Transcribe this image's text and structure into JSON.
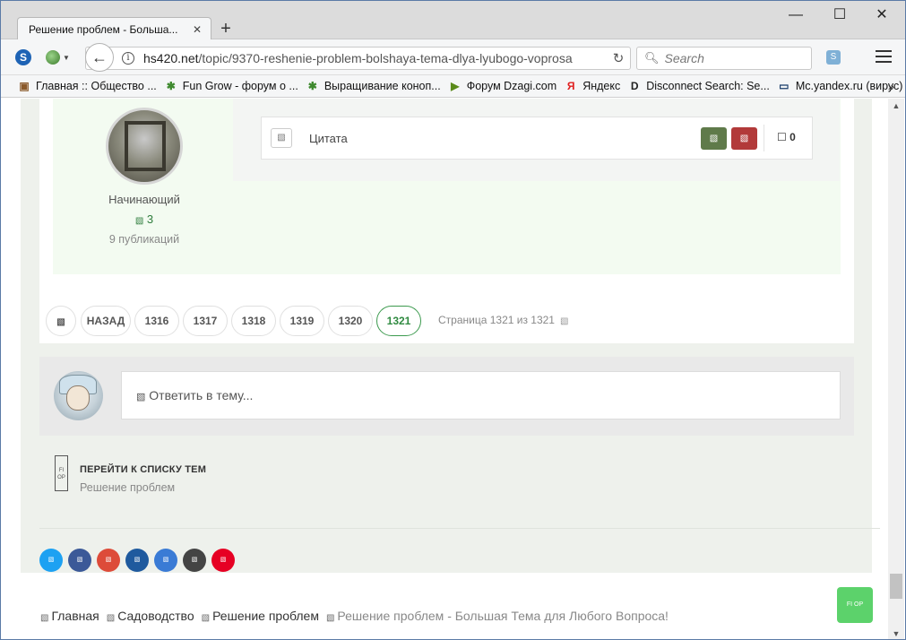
{
  "browser": {
    "tab_title": "Решение проблем - Больша...",
    "url_domain": "hs420.net",
    "url_path": "/topic/9370-reshenie-problem-bolshaya-tema-dlya-lyubogo-voprosa",
    "search_placeholder": "Search",
    "window_controls": {
      "minimize": "—",
      "maximize": "☐",
      "close": "✕"
    }
  },
  "bookmarks": [
    {
      "label": "Главная :: Общество ...",
      "icon": "site-icon",
      "color": "#8a5a2b"
    },
    {
      "label": "Fun Grow - форум о ...",
      "icon": "leaf-icon",
      "color": "#3f8a2f"
    },
    {
      "label": "Выращивание коноп...",
      "icon": "leaf-icon",
      "color": "#3f8a2f"
    },
    {
      "label": "Форум Dzagi.com",
      "icon": "play-icon",
      "color": "#5a8a1a"
    },
    {
      "label": "Яндекс",
      "icon": "yandex-icon",
      "color": "#e02020"
    },
    {
      "label": "Disconnect Search: Se...",
      "icon": "d-icon",
      "color": "#222222"
    },
    {
      "label": "Mc.yandex.ru (вирус)",
      "icon": "monitor-icon",
      "color": "#1a3d6b"
    }
  ],
  "post": {
    "quote_label": "Цитата",
    "reaction_count": "0",
    "author": {
      "rank": "Начинающий",
      "reputation": "3",
      "posts": "9 публикаций"
    }
  },
  "pagination": {
    "prev_label": "НАЗАД",
    "pages": [
      "1316",
      "1317",
      "1318",
      "1319",
      "1320",
      "1321"
    ],
    "current_page": "1321",
    "info": "Страница 1321 из 1321"
  },
  "reply": {
    "placeholder": "Ответить в тему..."
  },
  "goto": {
    "title": "ПЕРЕЙТИ К СПИСКУ ТЕМ",
    "forum": "Решение проблем"
  },
  "share_buttons": [
    {
      "name": "share-twitter",
      "color": "#1da1f2"
    },
    {
      "name": "share-facebook",
      "color": "#3b5998"
    },
    {
      "name": "share-googleplus",
      "color": "#dd4b39"
    },
    {
      "name": "share-linkedin",
      "color": "#1f5a9e"
    },
    {
      "name": "share-digg",
      "color": "#3a7bd5"
    },
    {
      "name": "share-email",
      "color": "#444444"
    },
    {
      "name": "share-pinterest",
      "color": "#e60023"
    }
  ],
  "breadcrumb": [
    {
      "label": "Главная",
      "current": false
    },
    {
      "label": "Садоводство",
      "current": false
    },
    {
      "label": "Решение проблем",
      "current": false
    },
    {
      "label": "Решение проблем - Большая Тема для Любого Вопроса!",
      "current": true
    }
  ],
  "colors": {
    "accent_green": "#3c9a4e",
    "upvote": "#5f7a4a",
    "downvote": "#b23a3a",
    "scroll_top": "#5cd26b"
  }
}
